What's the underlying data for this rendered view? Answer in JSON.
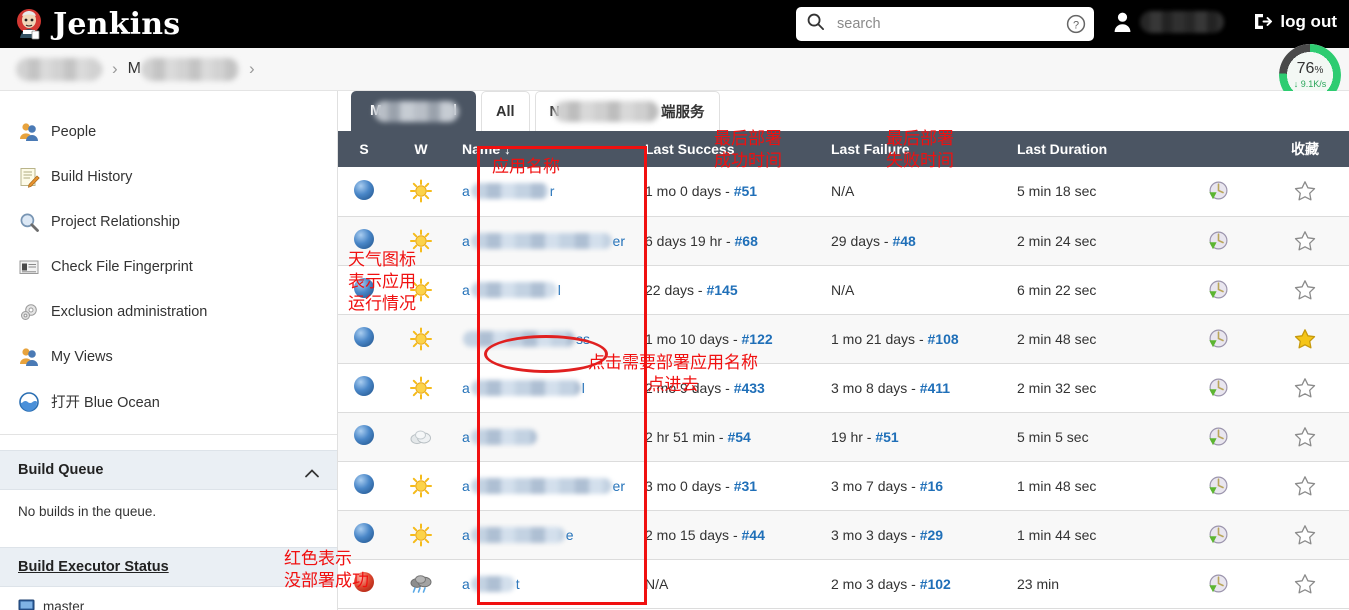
{
  "header": {
    "brand": "Jenkins",
    "logo_icon": "jenkins-butler-icon",
    "search_placeholder": "search",
    "search_value": "",
    "search_icon": "search-icon",
    "help_icon": "help-circle-icon",
    "user_icon": "person-icon",
    "user_name_blurred": true,
    "logout_label": "log out",
    "logout_icon": "logout-arrow-icon"
  },
  "breadcrumb": {
    "items": [
      "",
      ""
    ],
    "separator": ">"
  },
  "download_badge": {
    "percent": "76",
    "percent_symbol": "%",
    "rate": "↓ 9.1K/s",
    "ring_color": "#2ecc71",
    "progress": 76
  },
  "sidebar": {
    "items": [
      {
        "label": "People",
        "icon": "people-icon"
      },
      {
        "label": "Build History",
        "icon": "notepad-pencil-icon"
      },
      {
        "label": "Project Relationship",
        "icon": "magnifier-icon"
      },
      {
        "label": "Check File Fingerprint",
        "icon": "fingerprint-card-icon"
      },
      {
        "label": "Exclusion administration",
        "icon": "gears-icon"
      },
      {
        "label": "My Views",
        "icon": "people-icon"
      },
      {
        "label": "打开 Blue Ocean",
        "icon": "blue-ocean-icon"
      }
    ],
    "build_queue": {
      "title": "Build Queue",
      "collapse_icon": "chevron-up-icon",
      "empty_text": "No builds in the queue."
    },
    "build_executor": {
      "title": "Build Executor Status",
      "collapse_icon": "chevron-up-icon",
      "nodes": [
        {
          "label": "master",
          "icon": "computer-icon"
        }
      ]
    }
  },
  "tabs": [
    {
      "label": "",
      "blurred": true,
      "active": true
    },
    {
      "label": "All",
      "blurred": false,
      "active": false
    },
    {
      "label": "端服务",
      "blurred": true,
      "active": false
    }
  ],
  "table": {
    "columns": [
      "S",
      "W",
      "Name ↓",
      "Last Success",
      "Last Failure",
      "Last Duration",
      "收藏"
    ],
    "rows": [
      {
        "status": "blue",
        "weather": "sunny",
        "name_suffix": "r",
        "name_blur_width": 78,
        "name_prefix": "a",
        "last_success": "1 mo 0 days - ",
        "last_success_build": "#51",
        "last_failure": "N/A",
        "last_failure_build": "",
        "last_duration": "5 min 18 sec",
        "trigger_icon": "schedule-build-icon",
        "favorite": false
      },
      {
        "status": "blue",
        "weather": "sunny",
        "name_suffix": "er",
        "name_blur_width": 148,
        "name_prefix": "a",
        "last_success": "6 days 19 hr - ",
        "last_success_build": "#68",
        "last_failure": "29 days - ",
        "last_failure_build": "#48",
        "last_duration": "2 min 24 sec",
        "trigger_icon": "schedule-build-icon",
        "favorite": false
      },
      {
        "status": "blue",
        "weather": "sunny",
        "name_suffix": "l",
        "name_blur_width": 86,
        "name_prefix": "a",
        "last_success": "22 days - ",
        "last_success_build": "#145",
        "last_failure": "N/A",
        "last_failure_build": "",
        "last_duration": "6 min 22 sec",
        "trigger_icon": "schedule-build-icon",
        "favorite": false
      },
      {
        "status": "blue",
        "weather": "sunny",
        "name_suffix": "ss",
        "name_blur_width": 112,
        "name_prefix": "",
        "last_success": "1 mo 10 days - ",
        "last_success_build": "#122",
        "last_failure": "1 mo 21 days - ",
        "last_failure_build": "#108",
        "last_duration": "2 min 48 sec",
        "trigger_icon": "schedule-build-icon",
        "favorite": true
      },
      {
        "status": "blue",
        "weather": "sunny",
        "name_suffix": "l",
        "name_blur_width": 110,
        "name_prefix": "a",
        "last_success": "2 mo 9 days - ",
        "last_success_build": "#433",
        "last_failure": "3 mo 8 days - ",
        "last_failure_build": "#411",
        "last_duration": "2 min 32 sec",
        "trigger_icon": "schedule-build-icon",
        "favorite": false
      },
      {
        "status": "blue",
        "weather": "cloudy",
        "name_suffix": "",
        "name_blur_width": 66,
        "name_prefix": "a",
        "last_success": "2 hr 51 min - ",
        "last_success_build": "#54",
        "last_failure": "19 hr - ",
        "last_failure_build": "#51",
        "last_duration": "5 min 5 sec",
        "trigger_icon": "schedule-build-icon",
        "favorite": false
      },
      {
        "status": "blue",
        "weather": "sunny",
        "name_suffix": "er",
        "name_blur_width": 146,
        "name_prefix": "a",
        "last_success": "3 mo 0 days - ",
        "last_success_build": "#31",
        "last_failure": "3 mo 7 days - ",
        "last_failure_build": "#16",
        "last_duration": "1 min 48 sec",
        "trigger_icon": "schedule-build-icon",
        "favorite": false
      },
      {
        "status": "blue",
        "weather": "sunny",
        "name_suffix": "e",
        "name_blur_width": 94,
        "name_prefix": "a",
        "last_success": "2 mo 15 days - ",
        "last_success_build": "#44",
        "last_failure": "3 mo 3 days - ",
        "last_failure_build": "#29",
        "last_duration": "1 min 44 sec",
        "trigger_icon": "schedule-build-icon",
        "favorite": false
      },
      {
        "status": "red",
        "weather": "storm",
        "name_suffix": "t",
        "name_blur_width": 44,
        "name_prefix": "a",
        "last_success": "N/A",
        "last_success_build": "",
        "last_failure": "2 mo 3 days - ",
        "last_failure_build": "#102",
        "last_duration": "23 min",
        "trigger_icon": "schedule-build-icon",
        "favorite": false
      }
    ]
  },
  "annotations": {
    "color": "#f01010",
    "name_column_label": "应用名称",
    "last_success_label": "最后部署\n成功时间",
    "last_failure_label": "最后部署\n失败时间",
    "weather_label": "天气图标\n表示应用\n运行情况",
    "click_name_label": "点击需要部署应用名称\n点进去",
    "red_status_label": "红色表示\n没部署成功"
  }
}
